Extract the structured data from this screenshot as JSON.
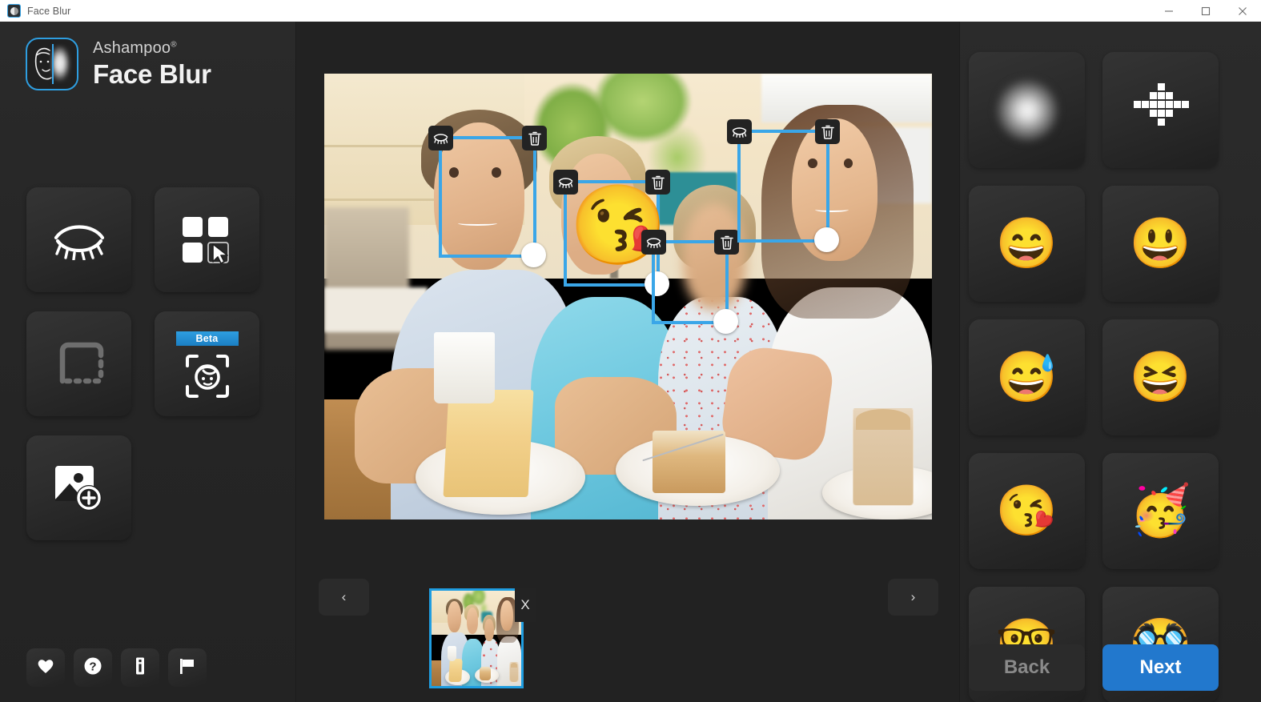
{
  "window": {
    "title": "Face Blur",
    "app_icon": "face-blur-app-icon",
    "controls": {
      "minimize": "minimize-icon",
      "maximize": "maximize-icon",
      "close": "close-icon"
    }
  },
  "brand": {
    "company": "Ashampoo",
    "registered": "®",
    "product": "Face Blur",
    "logo_icon": "face-half-blur-logo"
  },
  "sidebar": {
    "tools": [
      {
        "name": "blur-faces-tool",
        "icon": "closed-eye-icon",
        "label": "Blur faces",
        "badge": null
      },
      {
        "name": "select-areas-tool",
        "icon": "grid-select-cursor-icon",
        "label": "Select areas",
        "badge": null
      },
      {
        "name": "free-shape-tool",
        "icon": "dashed-rectangle-icon",
        "label": "Free shape",
        "badge": null
      },
      {
        "name": "auto-detect-tool",
        "icon": "face-scan-icon",
        "label": "Auto face detect",
        "badge": "Beta"
      },
      {
        "name": "add-image-tool",
        "icon": "add-image-icon",
        "label": "Add image",
        "badge": null
      }
    ],
    "footer_icons": [
      {
        "name": "favorites-button",
        "icon": "heart-icon"
      },
      {
        "name": "help-button",
        "icon": "question-mark-icon"
      },
      {
        "name": "info-button",
        "icon": "info-icon"
      },
      {
        "name": "feedback-button",
        "icon": "flag-icon"
      }
    ]
  },
  "workspace": {
    "image_alt": "Family of four at an outdoor cafe table with cake and coffee",
    "faces": [
      {
        "name": "face-box-man",
        "state": "unmodified",
        "eye_icon": "closed-eye-icon",
        "delete_icon": "trash-icon",
        "handle": "resize-handle"
      },
      {
        "name": "face-box-boy",
        "state": "emoji",
        "emoji": "😘",
        "eye_icon": "closed-eye-icon",
        "delete_icon": "trash-icon",
        "handle": "resize-handle"
      },
      {
        "name": "face-box-girl",
        "state": "blurred",
        "eye_icon": "closed-eye-icon",
        "delete_icon": "trash-icon",
        "handle": "resize-handle"
      },
      {
        "name": "face-box-woman",
        "state": "unmodified",
        "eye_icon": "closed-eye-icon",
        "delete_icon": "trash-icon",
        "handle": "resize-handle"
      }
    ],
    "filmstrip": {
      "prev_label": "‹",
      "next_label": "›",
      "thumb_close_label": "X",
      "thumb_selected": true
    }
  },
  "effects": {
    "items": [
      {
        "name": "effect-blur",
        "type": "blur",
        "label": "Blur"
      },
      {
        "name": "effect-pixelate",
        "type": "pixel",
        "label": "Pixelate"
      },
      {
        "name": "effect-grin",
        "type": "emoji",
        "glyph": "😄",
        "label": "Grinning face with smiling eyes"
      },
      {
        "name": "effect-open-mouth",
        "type": "emoji",
        "glyph": "😃",
        "label": "Grinning face with big eyes"
      },
      {
        "name": "effect-sweat-smile",
        "type": "emoji",
        "glyph": "😅",
        "label": "Grinning face with sweat"
      },
      {
        "name": "effect-squint-laugh",
        "type": "emoji",
        "glyph": "😆",
        "label": "Grinning squinting face"
      },
      {
        "name": "effect-kiss-heart",
        "type": "emoji",
        "glyph": "😘",
        "label": "Face blowing a kiss"
      },
      {
        "name": "effect-partying",
        "type": "emoji",
        "glyph": "🥳",
        "label": "Partying face"
      },
      {
        "name": "effect-nerd",
        "type": "emoji",
        "glyph": "🤓",
        "label": "Nerd face"
      },
      {
        "name": "effect-disguised",
        "type": "emoji",
        "glyph": "🥸",
        "label": "Disguised face"
      }
    ]
  },
  "actions": {
    "back_label": "Back",
    "next_label": "Next",
    "accent_color": "#2278cd"
  }
}
